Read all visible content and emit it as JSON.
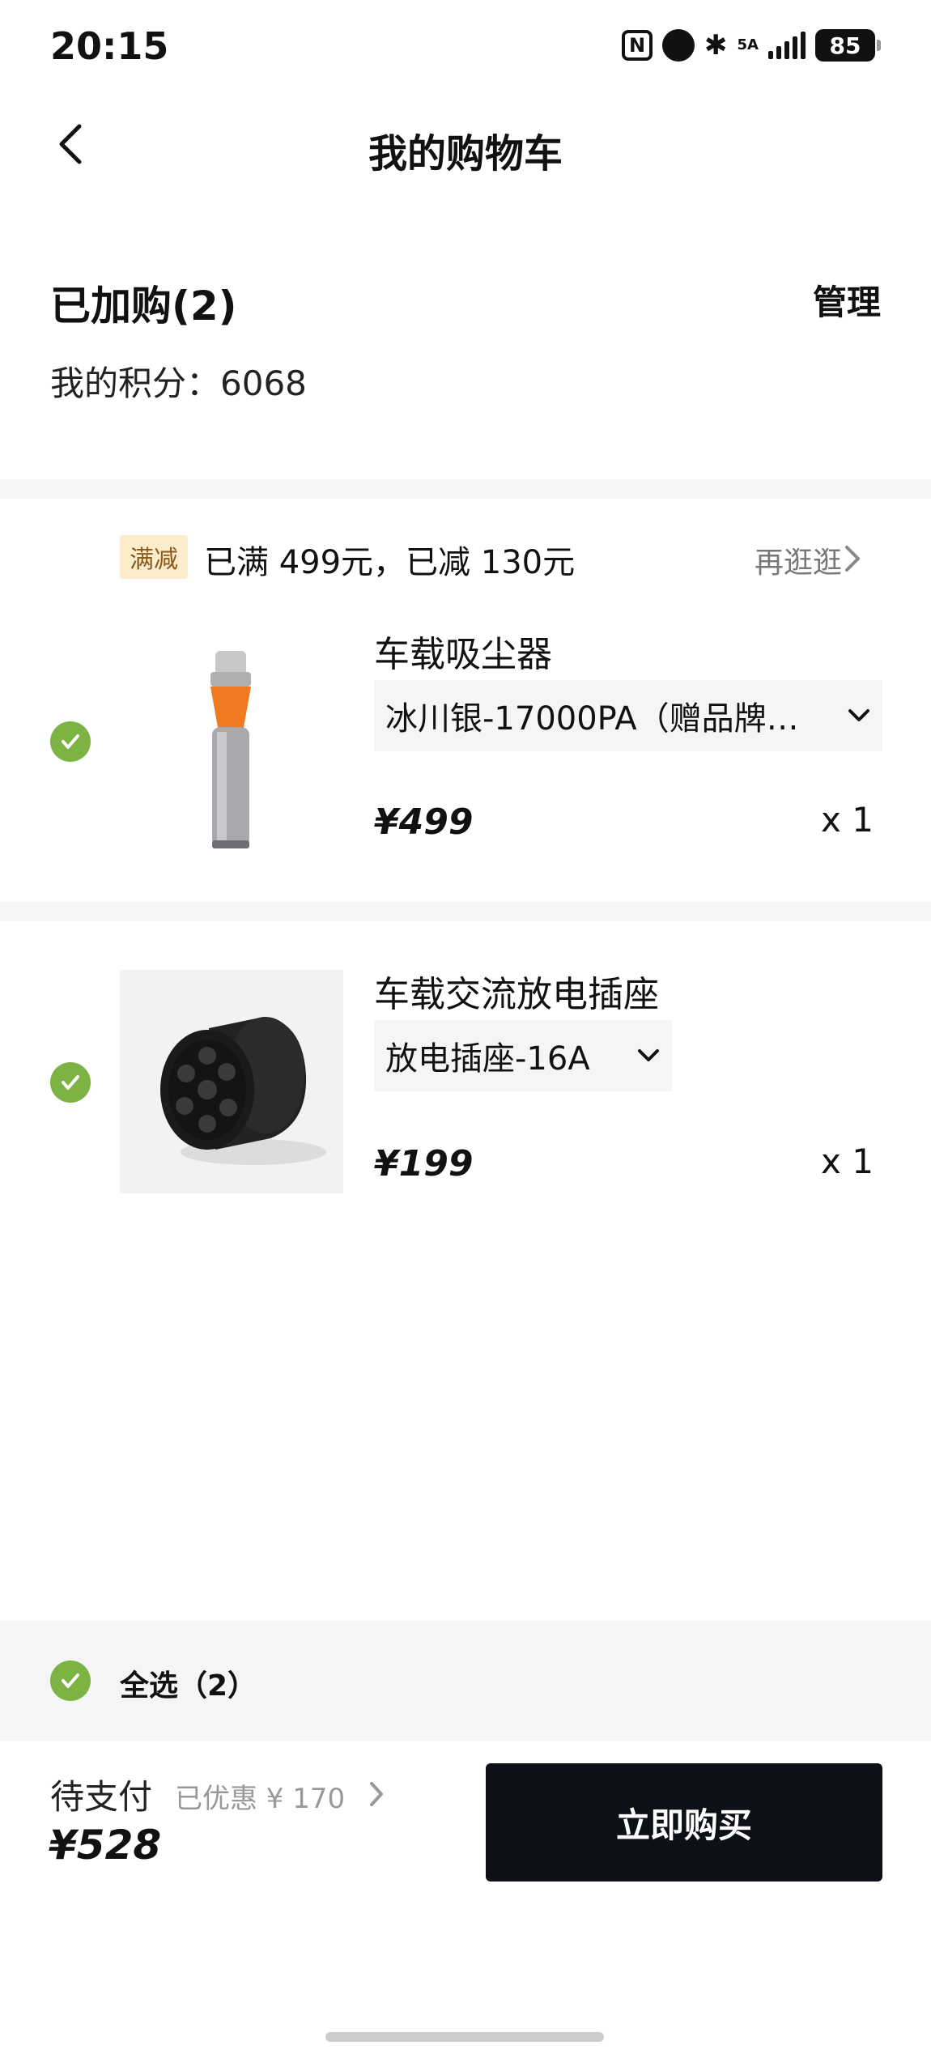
{
  "status_bar": {
    "time": "20:15",
    "network": "5A",
    "battery": "85"
  },
  "header": {
    "title": "我的购物车"
  },
  "summary": {
    "added_label": "已加购(2)",
    "manage_label": "管理",
    "points_label": "我的积分：",
    "points_value": "6068"
  },
  "promo": {
    "tag": "满减",
    "text": "已满 499元，已减 130元",
    "more_label": "再逛逛"
  },
  "items": [
    {
      "name": "车载吸尘器",
      "variant": "冰川银-17000PA（赠品牌…",
      "price": "¥499",
      "qty": "x 1",
      "checked": true
    },
    {
      "name": "车载交流放电插座",
      "variant": "放电插座-16A",
      "price": "¥199",
      "qty": "x 1",
      "checked": true
    }
  ],
  "footer": {
    "select_all_label": "全选（2）",
    "pay_label": "待支付",
    "discount_text": "已优惠 ¥ 170",
    "total": "¥528",
    "buy_label": "立即购买"
  },
  "colors": {
    "check_green": "#7cb342",
    "buy_button": "#0d1117",
    "promo_tag_bg": "#fbeccb"
  }
}
